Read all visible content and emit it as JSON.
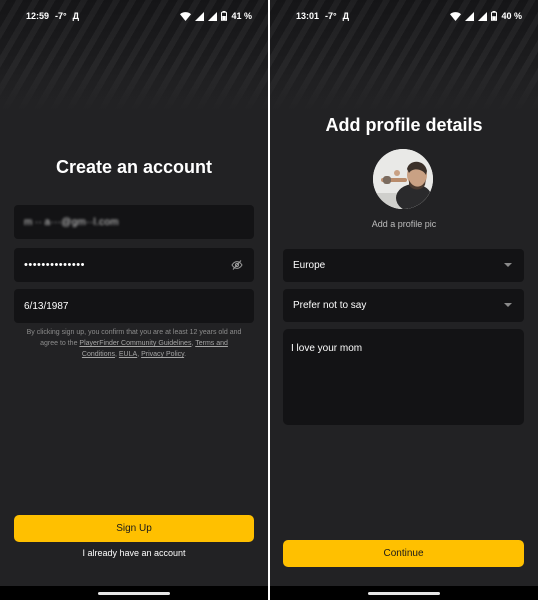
{
  "colors": {
    "accent": "#ffc000",
    "background": "#222224",
    "field": "#131315"
  },
  "left": {
    "status": {
      "time": "12:59",
      "temp": "-7°",
      "extra": "Д",
      "battery": "41 %"
    },
    "title": "Create an account",
    "email_value": "m ·· a···@gm··l.com",
    "password_value": "••••••••••••••",
    "birthdate_value": "6/13/1987",
    "legal": {
      "prefix": "By clicking sign up, you confirm that you are at least 12 years old and agree to the ",
      "guidelines": "PlayerFinder Community Guidelines",
      "comma1": ", ",
      "terms": "Terms and Conditions",
      "comma2": ", ",
      "eula": "EULA",
      "comma3": ", ",
      "privacy": "Privacy Policy",
      "suffix": "."
    },
    "signup_label": "Sign Up",
    "login_link": "I already have an account"
  },
  "right": {
    "status": {
      "time": "13:01",
      "temp": "-7°",
      "extra": "Д",
      "battery": "40 %"
    },
    "title": "Add profile details",
    "avatar_caption": "Add a profile pic",
    "region_value": "Europe",
    "gender_value": "Prefer not to say",
    "bio_value": "I love your mom",
    "continue_label": "Continue"
  },
  "icons": [
    "wifi-icon",
    "signal-icon",
    "battery-icon",
    "eye-off-icon",
    "chevron-down-icon",
    "home-pill"
  ]
}
